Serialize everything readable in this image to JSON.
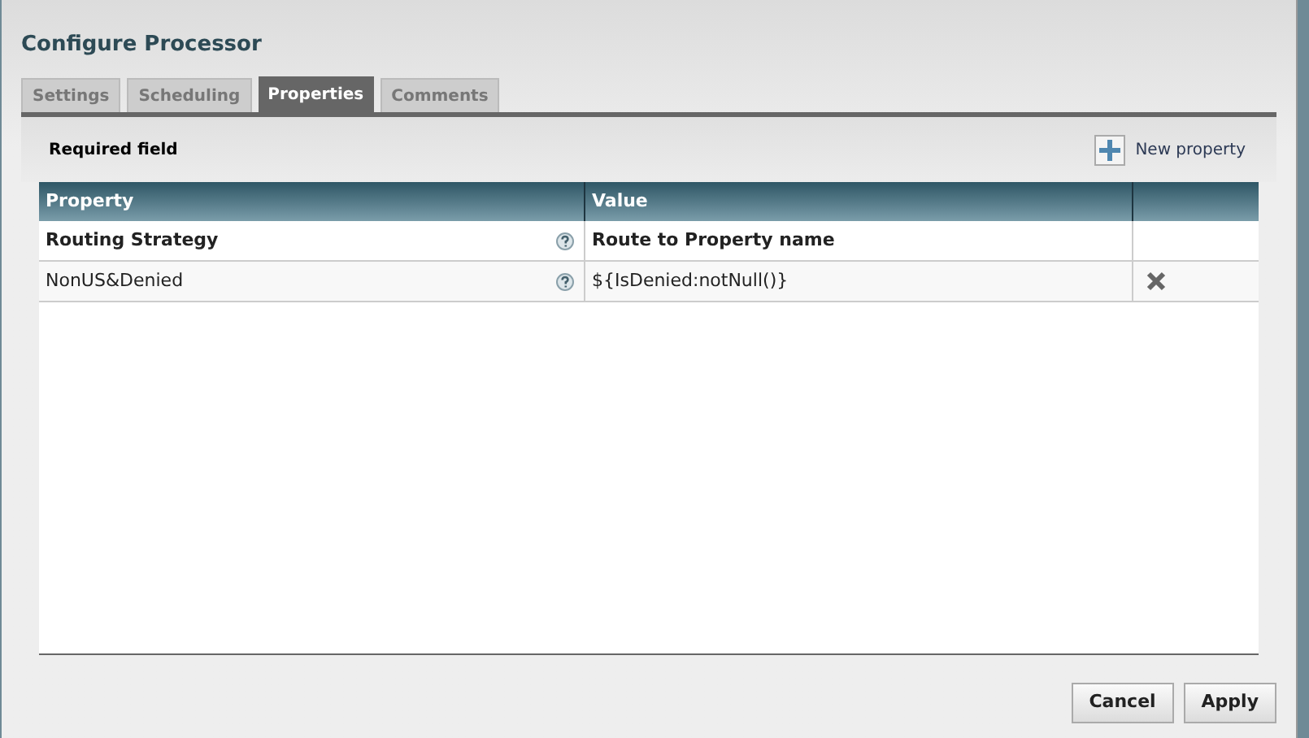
{
  "dialog": {
    "title": "Configure Processor"
  },
  "tabs": [
    {
      "label": "Settings",
      "selected": false
    },
    {
      "label": "Scheduling",
      "selected": false
    },
    {
      "label": "Properties",
      "selected": true
    },
    {
      "label": "Comments",
      "selected": false
    }
  ],
  "required_note": "Required field",
  "new_property_button": "New property",
  "table": {
    "columns": [
      "Property",
      "Value"
    ],
    "rows": [
      {
        "property": "Routing Strategy",
        "value": "Route to Property name",
        "required": true,
        "deletable": false
      },
      {
        "property": "NonUS&Denied",
        "value": "${IsDenied:notNull()}",
        "required": false,
        "deletable": true
      }
    ]
  },
  "buttons": [
    "Cancel",
    "Apply"
  ]
}
